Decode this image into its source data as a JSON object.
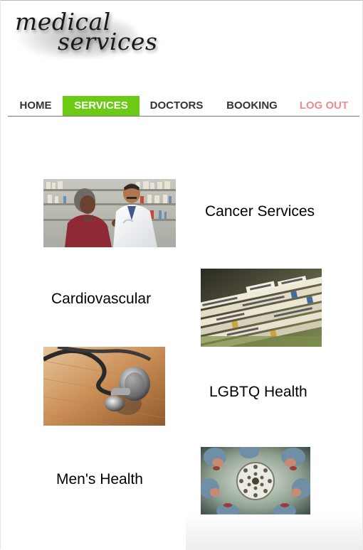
{
  "logo": {
    "line1": "medical",
    "line2": "services"
  },
  "nav": {
    "items": [
      {
        "label": "HOME"
      },
      {
        "label": "SERVICES"
      },
      {
        "label": "DOCTORS"
      },
      {
        "label": "BOOKING"
      },
      {
        "label": "LOG OUT"
      }
    ],
    "active": "SERVICES",
    "active_color": "#6bcb14",
    "logout_color": "#f08c8c"
  },
  "services": [
    {
      "label": "Cancer Services",
      "image": "pharmacist-consultation-photo"
    },
    {
      "label": "Cardiovascular",
      "image": "medical-records-files-photo"
    },
    {
      "label": "LGBTQ Health",
      "image": "stethoscope-photo"
    },
    {
      "label": "Men's Health",
      "image": "surgical-team-overhead-photo"
    }
  ]
}
